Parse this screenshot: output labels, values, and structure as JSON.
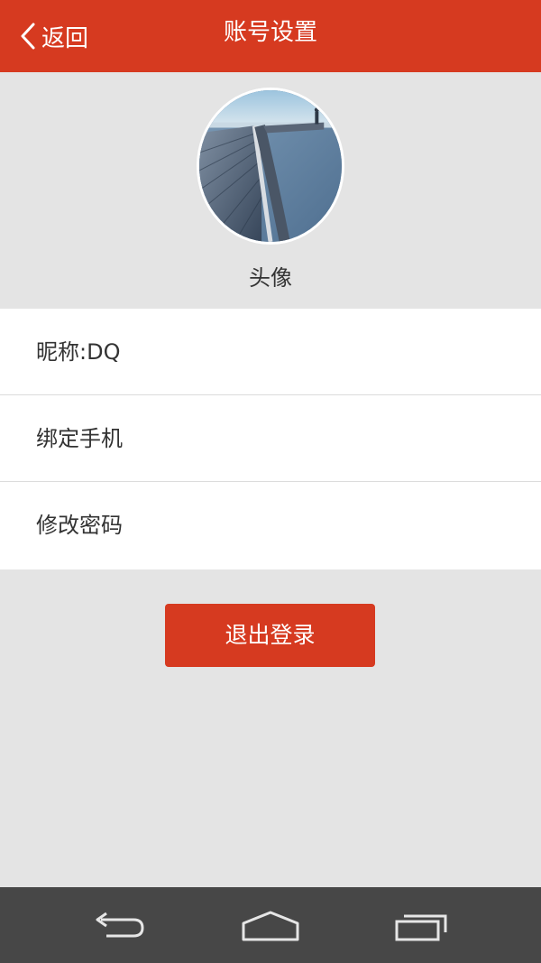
{
  "header": {
    "back_label": "返回",
    "title": "账号设置",
    "background_color": "#d63a20"
  },
  "profile": {
    "avatar_label": "头像",
    "avatar_image": "pier-photo"
  },
  "settings": {
    "items": [
      {
        "label": "昵称:DQ"
      },
      {
        "label": "绑定手机"
      },
      {
        "label": "修改密码"
      }
    ]
  },
  "actions": {
    "logout_label": "退出登录"
  },
  "navbar": {
    "icons": [
      "back-icon",
      "home-icon",
      "recent-apps-icon"
    ]
  }
}
